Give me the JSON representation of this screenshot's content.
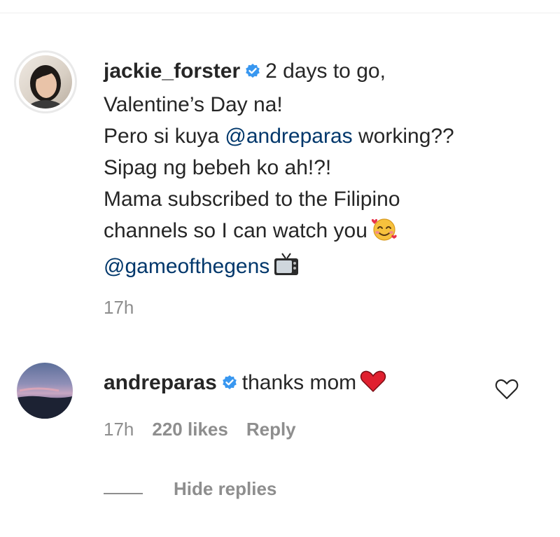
{
  "comment": {
    "username": "jackie_forster",
    "lines": [
      "2 days to go,",
      "Valentine’s Day na!",
      "Pero si kuya",
      "@andreparas",
      "working??",
      "Sipag ng bebeh ko ah!?!",
      "Mama subscribed to the Filipino",
      "channels so I can watch you",
      "@gameofthegens"
    ],
    "time": "17h",
    "emoji_1": "smiling-face-with-hearts",
    "emoji_2": "television"
  },
  "reply": {
    "username": "andreparas",
    "text": "thanks mom",
    "emoji": "red-heart",
    "time": "17h",
    "likes": "220 likes",
    "reply_label": "Reply"
  },
  "hide_replies": "Hide replies",
  "colors": {
    "mention": "#00376b",
    "verified": "#3897f0",
    "secondary_text": "#8e8e8e",
    "heart": "#ed4956"
  }
}
